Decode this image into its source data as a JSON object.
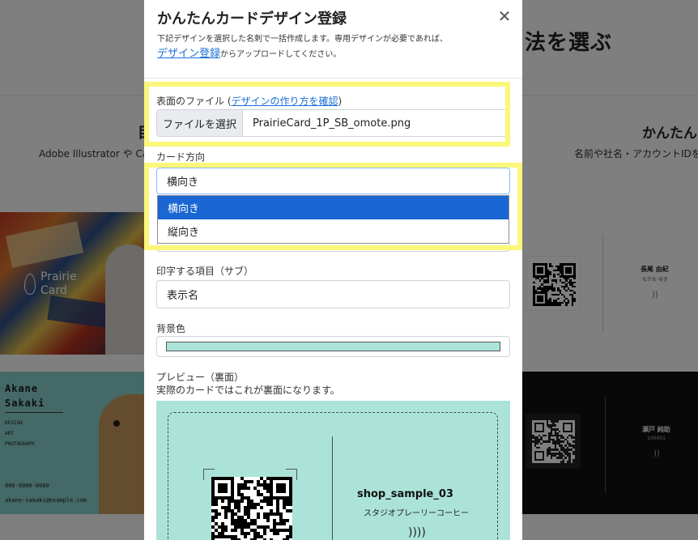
{
  "background": {
    "heading": "法を選ぶ",
    "left_column": {
      "title": "目",
      "subtitle": "Adobe Illustrator や Ca"
    },
    "right_column": {
      "title": "かんたんカ",
      "subtitle": "名前や社名・アカウントIDを用"
    },
    "cards": {
      "art_brand": "Prairie\nCard",
      "teal": {
        "name": "Akane\nSakaki",
        "roles": "DESIGN\nART\nPHOTOGRAPH",
        "phone": "000-0000-0000",
        "email": "akane-sakaki@example.com"
      },
      "white_right": {
        "name": "長尾 由紀",
        "sub": "ながお ゆき"
      },
      "black_right": {
        "name": "瀬戸 純助",
        "sub": "100001"
      }
    }
  },
  "modal": {
    "title": "かんたんカードデザイン登録",
    "close_icon": "close-icon",
    "description_line1": "下記デザインを選択した名刺で一括作成します。専用デザインが必要であれば、",
    "description_link": "デザイン登録",
    "description_line2_rest": "からアップロードしてください。",
    "front_file": {
      "label_prefix": "表面のファイル (",
      "label_link": "デザインの作り方を確認",
      "label_suffix": ")",
      "button_label": "ファイルを選択",
      "file_name": "PrairieCard_1P_SB_omote.png"
    },
    "orientation": {
      "label": "カード方向",
      "selected": "横向き",
      "options": [
        "横向き",
        "縦向き"
      ]
    },
    "print_item_sub": {
      "label": "印字する項目（サブ）",
      "value": "表示名"
    },
    "background_color": {
      "label": "背景色",
      "value": "#abe3d9"
    },
    "preview": {
      "label": "プレビュー（裏面）",
      "note": "実際のカードではこれが裏面になります。",
      "shop_name": "shop_sample_03",
      "shop_sub": "スタジオプレーリーコーヒー",
      "nfc_icon": "nfc-icon"
    }
  },
  "colors": {
    "highlight": "#fbf77a",
    "link": "#1a6fd6",
    "selected_option": "#1a66d2",
    "overlay": "rgba(0,0,0,0.5)"
  }
}
